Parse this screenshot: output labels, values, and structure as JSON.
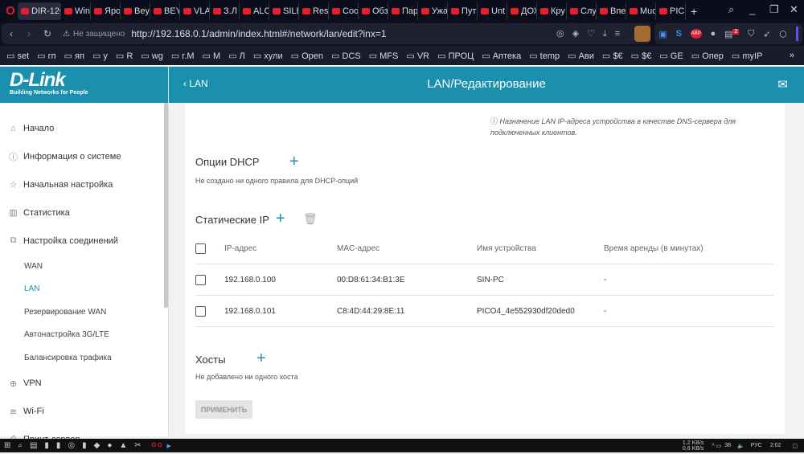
{
  "browser": {
    "tabs": [
      "DIR-12€",
      "Win",
      "Яро",
      "Bey",
      "BEY",
      "VLA",
      "З.Л",
      "ALC",
      "SILE",
      "Resi",
      "Coo",
      "Обз",
      "Пар",
      "Ужа",
      "Пут",
      "Unt",
      "ДОХ",
      "Кру",
      "Слу",
      "Впе",
      "Muc",
      "PICO"
    ],
    "insecure_label": "Не защищено",
    "url": "http://192.168.0.1/admin/index.html#/network/lan/edit?inx=1",
    "bookmarks": [
      "set",
      "гп",
      "яп",
      "у",
      "R",
      "wg",
      "r.M",
      "М",
      "Л",
      "хули",
      "Open",
      "DCS",
      "MFS",
      "VR",
      "ПРОЦ",
      "Аптека",
      "temp",
      "Ави",
      "$€",
      "$€",
      "GE",
      "Опер",
      "myIP"
    ],
    "ext_badge": "2"
  },
  "brand": {
    "name": "D-Link",
    "tagline": "Building Networks for People"
  },
  "header": {
    "back_label": "LAN",
    "title": "LAN/Редактирование"
  },
  "sidebar": {
    "items": [
      "Начало",
      "Информация о системе",
      "Начальная настройка",
      "Статистика",
      "Настройка соединений"
    ],
    "subitems": [
      "WAN",
      "LAN",
      "Резервирование WAN",
      "Автонастройка 3G/LTE",
      "Балансировка трафика"
    ],
    "items2": [
      "VPN",
      "Wi-Fi",
      "Принт-сервер"
    ]
  },
  "main": {
    "dns_note": "Назначение LAN IP-адреса устройства в качестве DNS-сервера для подключенных клиентов.",
    "dhcp_title": "Опции DHCP",
    "dhcp_empty": "Не создано ни одного правила для DHCP-опций",
    "static_title": "Статические IP",
    "columns": [
      "IP-адрес",
      "MAC-адрес",
      "Имя устройства",
      "Время аренды (в минутах)"
    ],
    "rows": [
      [
        "192.168.0.100",
        "00:D8:61:34:B1:3E",
        "SIN-PC",
        "-"
      ],
      [
        "192.168.0.101",
        "C8:4D:44:29:8E:11",
        "PICO4_4e552930df20ded0",
        "-"
      ]
    ],
    "hosts_title": "Хосты",
    "hosts_empty": "Не добавлено ни одного хоста",
    "apply_label": "ПРИМЕНИТЬ"
  },
  "taskbar": {
    "net_up": "1,2 KB/s",
    "net_down": "0,6 KB/s",
    "temp": "38",
    "lang": "РУС",
    "time": "2:02"
  },
  "colors": {
    "accent": "#1b8fae"
  }
}
